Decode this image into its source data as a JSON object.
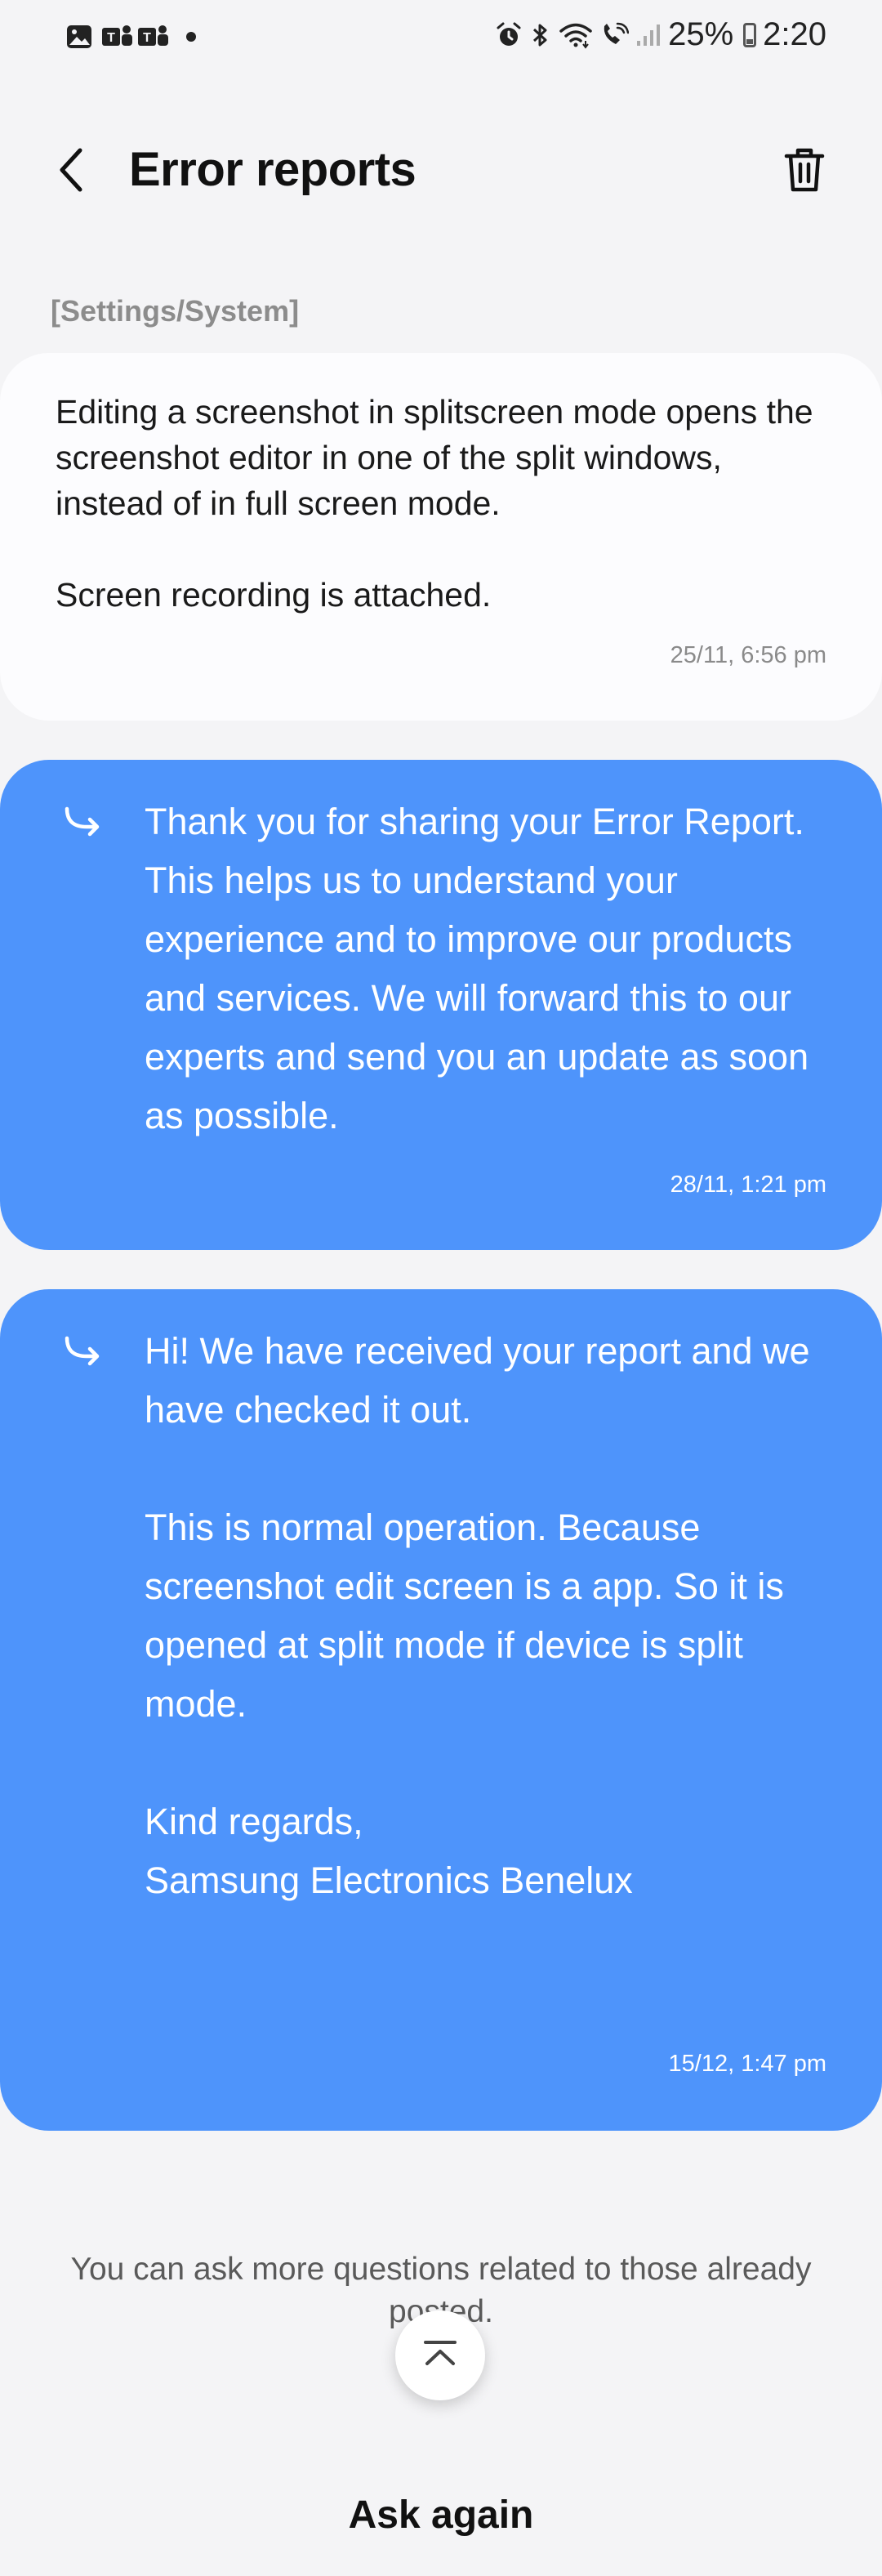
{
  "status_bar": {
    "battery_percent": "25%",
    "time": "2:20"
  },
  "header": {
    "title": "Error reports"
  },
  "report": {
    "category": "[Settings/System]",
    "message": "Editing a screenshot in splitscreen mode opens the screenshot editor in one of the split windows, instead of in full screen mode.\n\nScreen recording is attached.",
    "timestamp": "25/11, 6:56 pm"
  },
  "replies": [
    {
      "message": "Thank you for sharing your Error Report. This helps us to understand your experience and to improve our products and services. We will forward this to our experts and send you an update as soon as possible.",
      "timestamp": "28/11, 1:21 pm"
    },
    {
      "message": "Hi! We have received your report and we have checked it out.\n\nThis is normal operation. Because screenshot edit screen is a app. So it is opened at split mode if device is split mode.\n\nKind regards,\nSamsung Electronics Benelux",
      "timestamp": "15/12, 1:47 pm"
    }
  ],
  "footer": {
    "hint": "You can ask more questions related to those already posted.",
    "ask_again_label": "Ask again"
  },
  "colors": {
    "reply_card": "#4e94fb",
    "user_card": "#fcfcfe",
    "background": "#f4f4f6"
  },
  "icons": [
    "gallery-icon",
    "teams-icon",
    "teams-icon",
    "alarm-icon",
    "bluetooth-icon",
    "wifi-icon",
    "wifi-call-icon",
    "signal-icon",
    "battery-icon",
    "back-arrow-icon",
    "trash-icon",
    "reply-arrow-icon",
    "chevron-up-icon"
  ]
}
